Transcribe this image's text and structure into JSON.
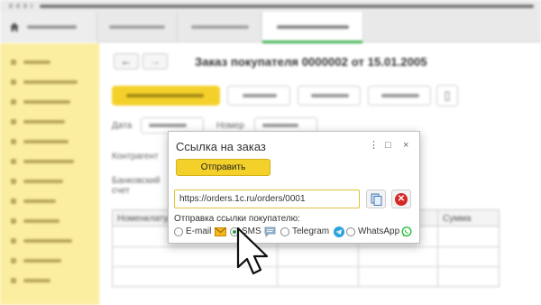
{
  "document": {
    "title": "Заказ покупателя 0000002 от 15.01.2005",
    "date_label": "Дата",
    "number_label": "Номер",
    "counterparty_label": "Контрагент",
    "bank_account_label": "Банковский счет"
  },
  "table": {
    "columns": [
      "Номенклатура",
      "Сумма"
    ]
  },
  "dialog": {
    "title": "Ссылка на заказ",
    "send_button": "Отправить",
    "url_value": "https://orders.1c.ru/orders/0001",
    "send_link_label": "Отправка ссылки покупателю:",
    "options": [
      {
        "label": "E-mail",
        "icon": "envelope-icon",
        "selected": false
      },
      {
        "label": "SMS",
        "icon": "chat-bubble-icon",
        "selected": true
      },
      {
        "label": "Telegram",
        "icon": "telegram-icon",
        "selected": false
      },
      {
        "label": "WhatsApp",
        "icon": "whatsapp-icon",
        "selected": false
      }
    ]
  },
  "colors": {
    "accent_yellow": "#f4d12a",
    "sidebar_yellow": "#fbeea0",
    "active_tab_green": "#3fb051",
    "close_red": "#d62727",
    "telegram_blue": "#2aa3dc",
    "whatsapp_green": "#25c13a"
  }
}
